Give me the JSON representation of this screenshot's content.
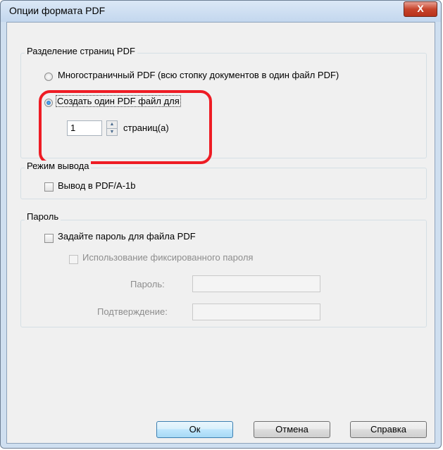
{
  "dialog": {
    "title": "Опции формата PDF",
    "close_label": "X"
  },
  "split_group": {
    "legend": "Разделение страниц PDF",
    "option_multipage": "Многостраничный PDF (всю стопку документов в один файл PDF)",
    "option_single": "Создать один PDF файл для",
    "pages_value": "1",
    "pages_suffix": "страниц(а)",
    "selected": "single"
  },
  "output_group": {
    "legend": "Режим вывода",
    "pdfa_label": "Вывод в PDF/A-1b",
    "pdfa_checked": false
  },
  "password_group": {
    "legend": "Пароль",
    "set_password_label": "Задайте пароль для файла PDF",
    "fixed_password_label": "Использование фиксированного пароля",
    "password_label": "Пароль:",
    "confirm_label": "Подтверждение:",
    "password_value": "",
    "confirm_value": ""
  },
  "buttons": {
    "ok": "Ок",
    "cancel": "Отмена",
    "help": "Справка"
  },
  "icons": {
    "spin_up": "spin-up-arrow-icon",
    "spin_down": "spin-down-arrow-icon"
  }
}
